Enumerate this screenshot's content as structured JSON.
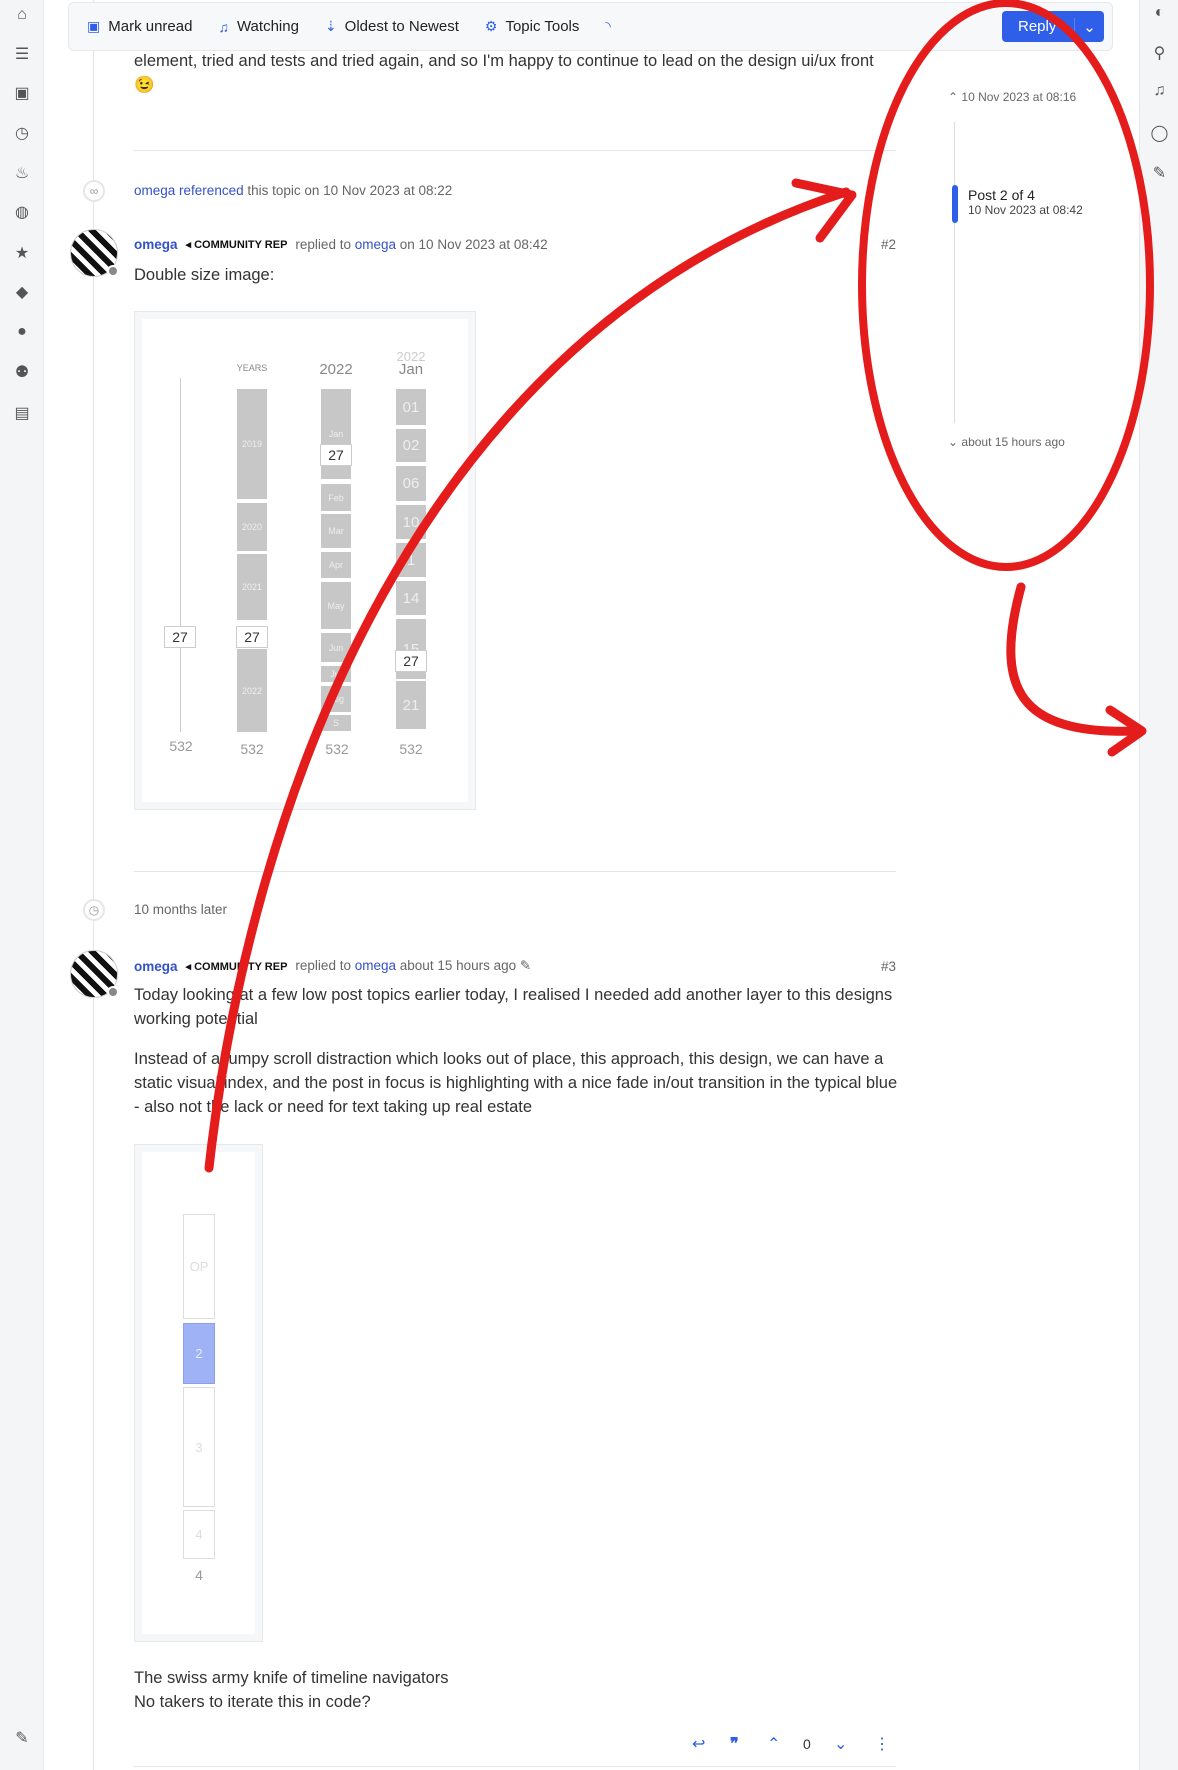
{
  "left_sidebar": {
    "icons": [
      "home-icon",
      "list-icon",
      "inbox-icon",
      "clock-icon",
      "fire-icon",
      "globe-icon",
      "star-icon",
      "tags-icon",
      "user-icon",
      "users-icon",
      "book-icon"
    ],
    "bottom_icon": "brush-icon"
  },
  "right_sidebar": {
    "icons": [
      "avatar-icon",
      "search-icon",
      "bell-icon",
      "chat-icon",
      "edit-icon"
    ]
  },
  "topbar": {
    "mark_unread": "Mark unread",
    "watching": "Watching",
    "sort": "Oldest to Newest",
    "topic_tools": "Topic Tools",
    "reply": "Reply"
  },
  "post1": {
    "text": "element, tried and tests and tried again, and so I'm happy to continue to lead on the design ui/ux front",
    "emoji": "😉"
  },
  "reference": {
    "user": "omega",
    "action": "referenced",
    "text": "this topic on 10 Nov 2023 at 08:22"
  },
  "post2": {
    "user": "omega",
    "badge": "COMMUNITY REP",
    "replied": "replied to",
    "reply_to": "omega",
    "time": "on 10 Nov 2023 at 08:42",
    "number": "#2",
    "text": "Double size image:",
    "image": {
      "slider": {
        "value": "27",
        "total": "532"
      },
      "years": {
        "header": "YEARS",
        "segments": [
          "2019",
          "2020",
          "2021",
          "2022"
        ],
        "value": "27",
        "total": "532"
      },
      "months": {
        "header": "2022",
        "segments": [
          "Jan",
          "Feb",
          "Mar",
          "Apr",
          "May",
          "Jun",
          "Jul",
          "Aug",
          "S"
        ],
        "value": "27",
        "total": "532"
      },
      "days": {
        "header_top": "2022",
        "header": "Jan",
        "segments": [
          "01",
          "02",
          "06",
          "10",
          "1",
          "14",
          "15",
          "21"
        ],
        "value": "27",
        "total": "532"
      }
    }
  },
  "gap": {
    "text": "10 months later"
  },
  "post3": {
    "user": "omega",
    "badge": "COMMUNITY REP",
    "replied": "replied to",
    "reply_to": "omega",
    "time": "about 15 hours ago",
    "number": "#3",
    "para1": "Today looking at a few low post topics earlier today, I realised I needed add another layer to this designs working potential",
    "para2": "Instead of a jumpy scroll distraction which looks out of place, this approach, this design, we can have a static visual index, and the post in focus is highlighting with a nice fade in/out transition in the typical blue - also not the lack or need for text taking up real estate",
    "image": {
      "segments": [
        "OP",
        "2",
        "3",
        "4"
      ],
      "active": "2",
      "total": "4",
      "highlight_color": "#9fb2f5"
    },
    "line1": "The swiss army knife of timeline navigators",
    "line2": "No takers to iterate this in code?",
    "likes": "0"
  },
  "timeline": {
    "top": "10 Nov 2023 at 08:16",
    "position": "Post 2 of 4",
    "position_date": "10 Nov 2023 at 08:42",
    "bottom": "about 15 hours ago",
    "progress": 0.25
  },
  "colors": {
    "accent": "#2f5ee8",
    "link": "#3451c7",
    "annotation": "#e51c1c"
  }
}
